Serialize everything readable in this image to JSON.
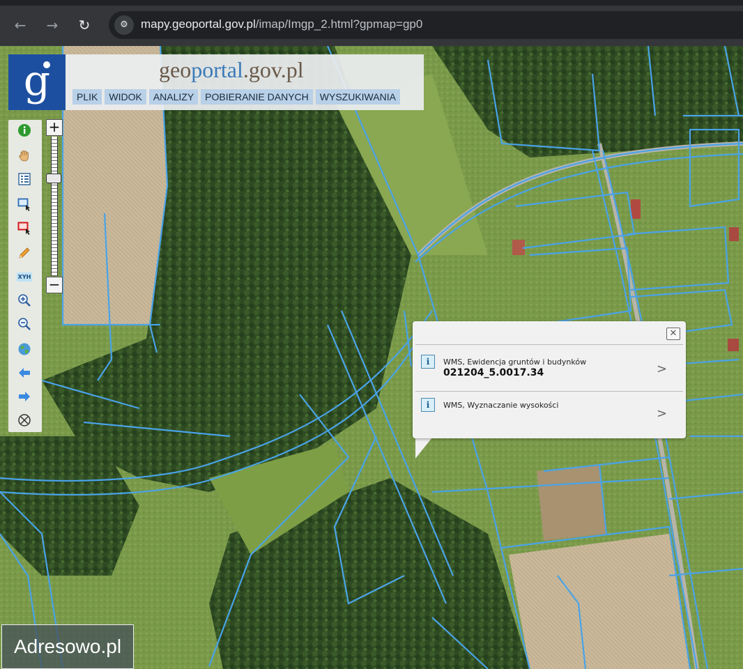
{
  "browser": {
    "url_host": "mapy.geoportal.gov.pl",
    "url_path": "/imap/Imgp_2.html?gpmap=gp0"
  },
  "header": {
    "title_prefix": "geo",
    "title_accent": "portal",
    "title_suffix": ".gov.pl",
    "menu": [
      "PLIK",
      "WIDOK",
      "ANALIZY",
      "POBIERANIE DANYCH",
      "WYSZUKIWANIA"
    ]
  },
  "toolbar": {
    "tools": [
      "info",
      "pan",
      "legend",
      "select-area",
      "select-delete",
      "draw",
      "coordinates",
      "zoom-in",
      "zoom-out",
      "full-extent",
      "back",
      "forward",
      "clear"
    ],
    "coords_label": "XYH"
  },
  "zoom": {
    "plus": "+",
    "minus": "−"
  },
  "popup": {
    "close": "✕",
    "rows": [
      {
        "source": "WMS, Ewidencja gruntów i budynków",
        "value": "021204_5.0017.34"
      },
      {
        "source": "WMS, Wyznaczanie wysokości",
        "value": ""
      }
    ],
    "arrow": ">",
    "info_glyph": "i"
  },
  "watermark": "Adresowo.pl",
  "colors": {
    "parcel_line": "#4aa3e8",
    "brand_blue": "#1d4fa0",
    "menu_bg": "#b8d0e8"
  }
}
